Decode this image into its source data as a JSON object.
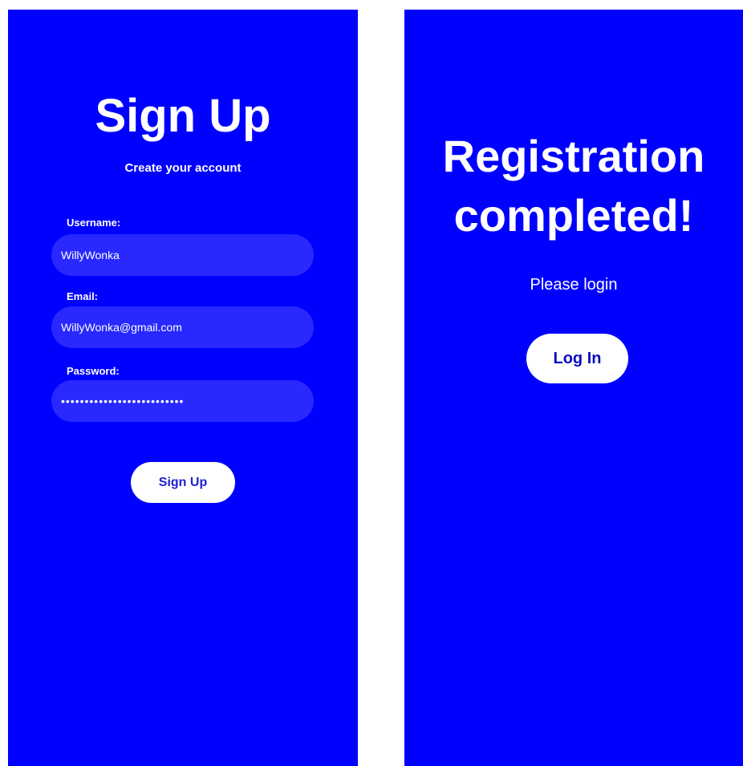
{
  "signup": {
    "title": "Sign Up",
    "subtitle": "Create your account",
    "username": {
      "label": "Username:",
      "value": "WillyWonka"
    },
    "email": {
      "label": "Email:",
      "value": "WillyWonka@gmail.com"
    },
    "password": {
      "label": "Password:",
      "value": "••••••••••••••••••••••••••"
    },
    "submit_label": "Sign Up"
  },
  "success": {
    "title": "Registration completed!",
    "message": "Please login",
    "login_label": "Log In"
  },
  "colors": {
    "panel_background": "#0000ff",
    "input_background": "#2828ff",
    "button_background": "#ffffff",
    "button_text": "#2020d0",
    "page_background": "#ffffff"
  }
}
